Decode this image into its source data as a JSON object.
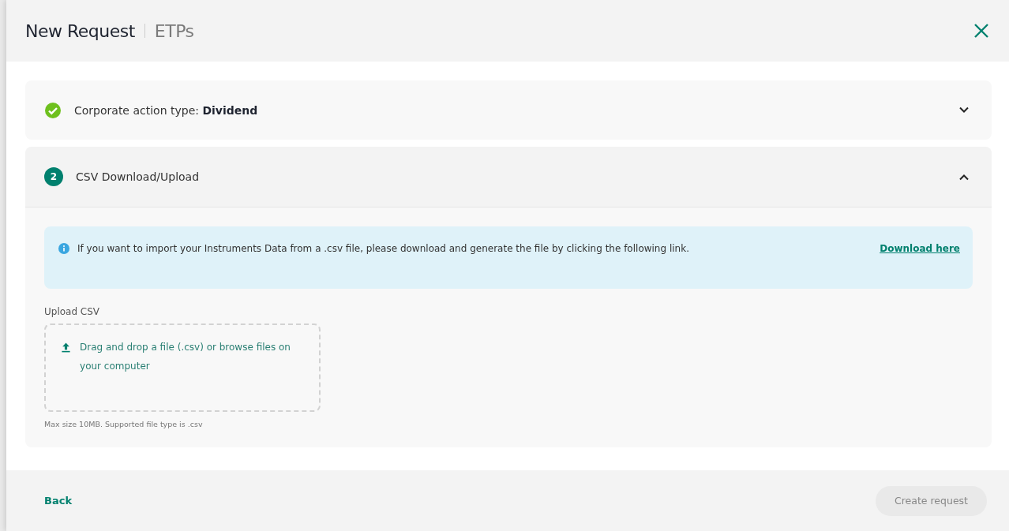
{
  "header": {
    "title": "New Request",
    "subtitle": "ETPs"
  },
  "steps": [
    {
      "kind": "done",
      "label": "Corporate action type: **Dividend**",
      "expanded": false
    },
    {
      "kind": "numbered",
      "number": "2",
      "label": "CSV Download/Upload",
      "expanded": true
    }
  ],
  "info": {
    "text": "If you want to import your Instruments Data from a .csv file, please download and generate the file by clicking the following link.",
    "link": "Download here"
  },
  "upload": {
    "label": "Upload CSV",
    "dropzone": "Drag and drop a file (.csv) or browse files on your computer",
    "hint": "Max size 10MB. Supported file type is .csv"
  },
  "footer": {
    "back": "Back",
    "submit": {
      "label": "Create request",
      "disabled": true
    }
  }
}
